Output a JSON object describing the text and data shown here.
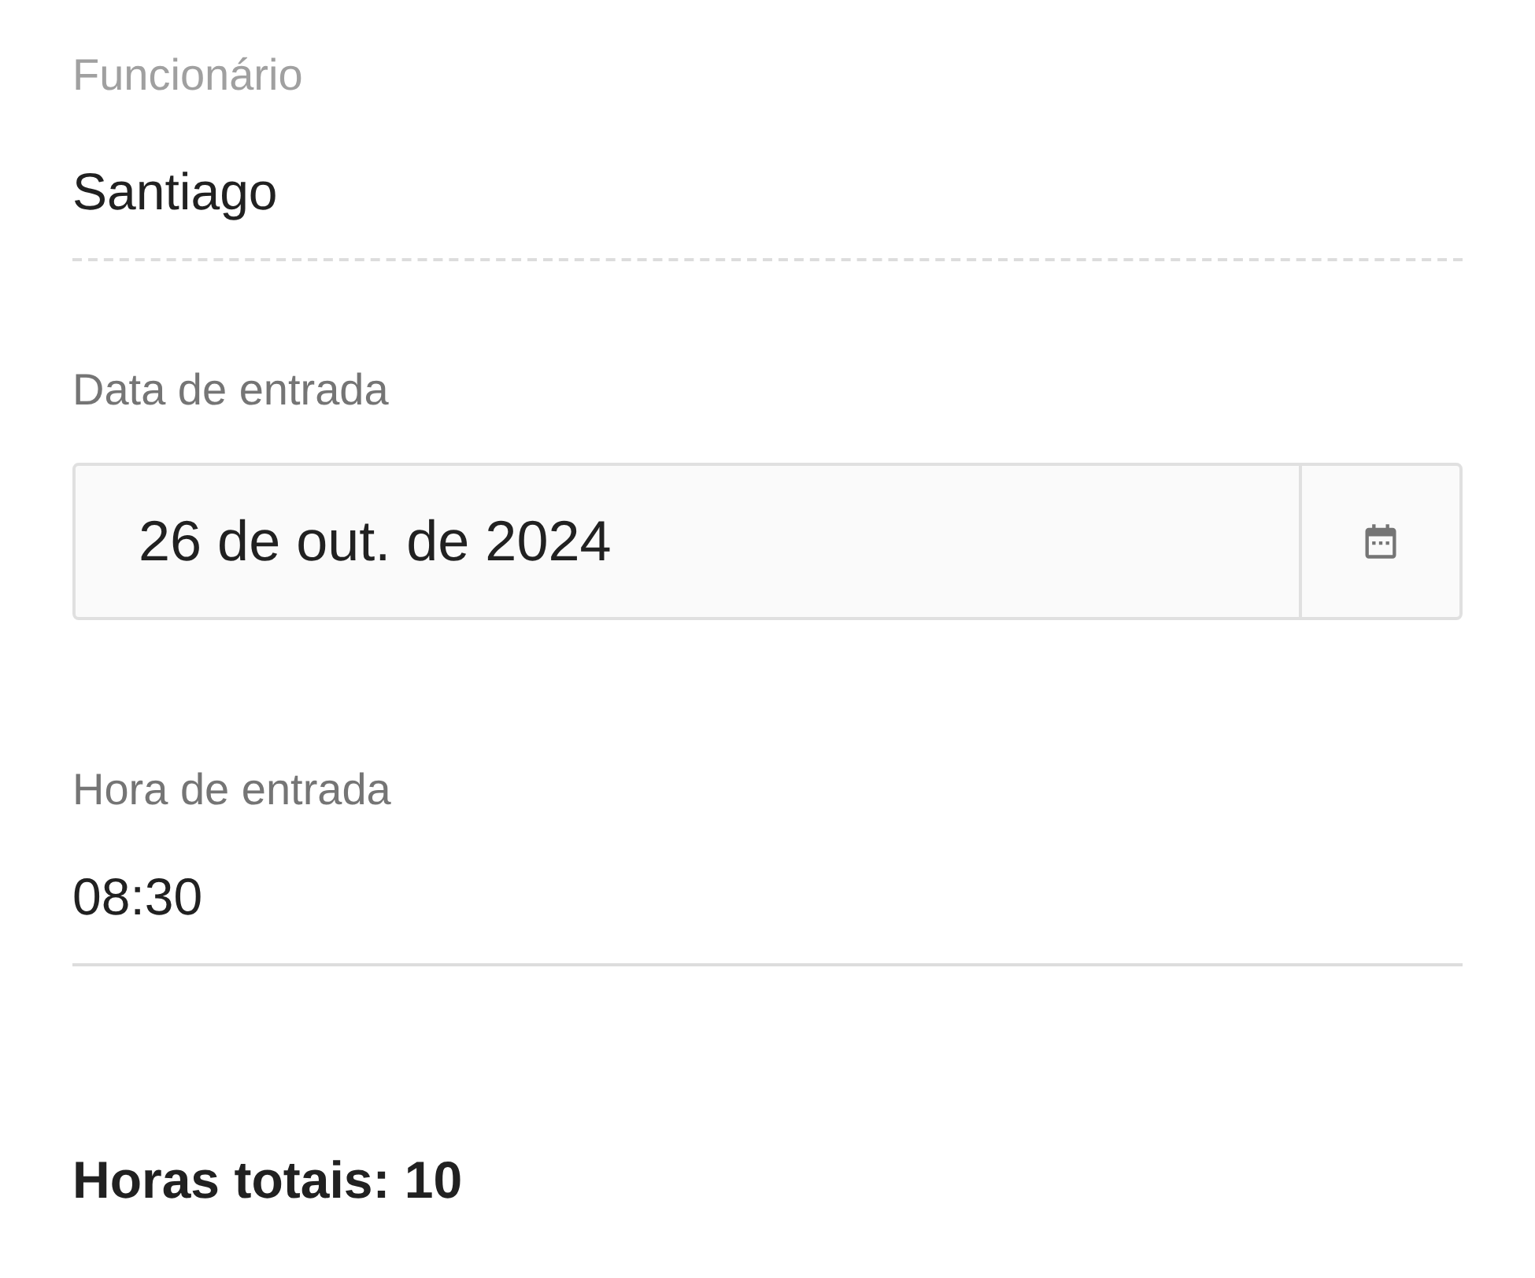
{
  "fields": [
    {
      "kind": "readonly",
      "label": "Funcionário",
      "value": "Santiago"
    },
    {
      "kind": "date",
      "label": "Data de entrada",
      "value": "26 de out. de 2024"
    },
    {
      "kind": "text",
      "label": "Hora de entrada",
      "value": "08:30"
    }
  ],
  "total": "Horas totais: 10"
}
